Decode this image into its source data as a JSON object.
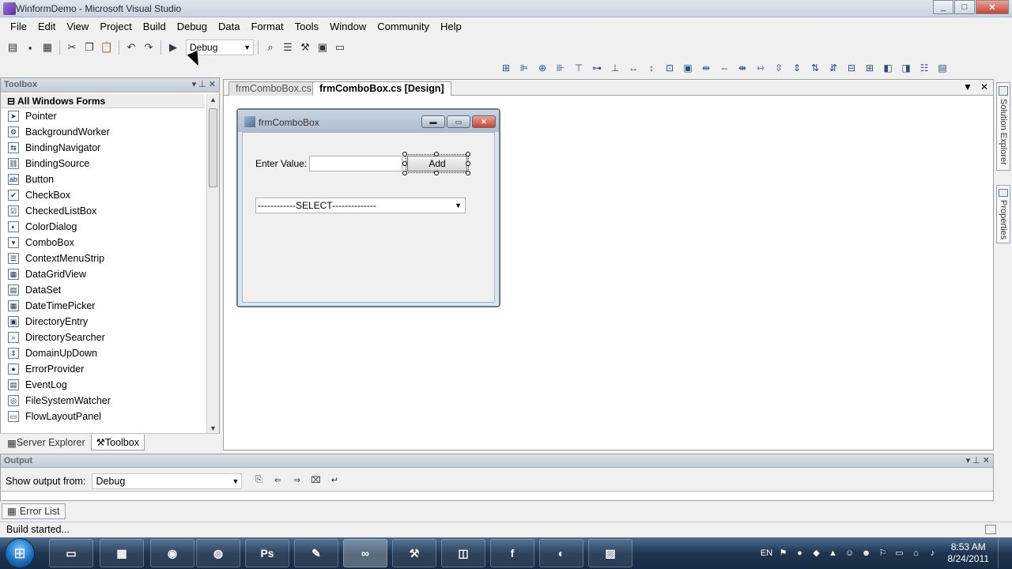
{
  "window": {
    "title": "WinformDemo - Microsoft Visual Studio",
    "controls": [
      "_",
      "□",
      "✕"
    ]
  },
  "menu": [
    "File",
    "Edit",
    "View",
    "Project",
    "Build",
    "Debug",
    "Data",
    "Format",
    "Tools",
    "Window",
    "Community",
    "Help"
  ],
  "toolbar": {
    "config_value": "Debug"
  },
  "toolbox": {
    "title": "Toolbox",
    "group": "All Windows Forms",
    "items": [
      {
        "label": "Pointer",
        "icon": "pointer-icon"
      },
      {
        "label": "BackgroundWorker",
        "icon": "background-worker-icon"
      },
      {
        "label": "BindingNavigator",
        "icon": "binding-navigator-icon"
      },
      {
        "label": "BindingSource",
        "icon": "binding-source-icon"
      },
      {
        "label": "Button",
        "icon": "button-icon"
      },
      {
        "label": "CheckBox",
        "icon": "checkbox-icon"
      },
      {
        "label": "CheckedListBox",
        "icon": "checked-listbox-icon"
      },
      {
        "label": "ColorDialog",
        "icon": "color-dialog-icon"
      },
      {
        "label": "ComboBox",
        "icon": "combobox-icon"
      },
      {
        "label": "ContextMenuStrip",
        "icon": "context-menu-strip-icon"
      },
      {
        "label": "DataGridView",
        "icon": "datagridview-icon"
      },
      {
        "label": "DataSet",
        "icon": "dataset-icon"
      },
      {
        "label": "DateTimePicker",
        "icon": "datetimepicker-icon"
      },
      {
        "label": "DirectoryEntry",
        "icon": "directory-entry-icon"
      },
      {
        "label": "DirectorySearcher",
        "icon": "directory-searcher-icon"
      },
      {
        "label": "DomainUpDown",
        "icon": "domain-updown-icon"
      },
      {
        "label": "ErrorProvider",
        "icon": "error-provider-icon"
      },
      {
        "label": "EventLog",
        "icon": "eventlog-icon"
      },
      {
        "label": "FileSystemWatcher",
        "icon": "filesystemwatcher-icon"
      },
      {
        "label": "FlowLayoutPanel",
        "icon": "flowlayoutpanel-icon"
      }
    ]
  },
  "panel_tabs": [
    "Server Explorer",
    "Toolbox"
  ],
  "document": {
    "tabs": [
      {
        "label": "frmComboBox.cs",
        "active": false
      },
      {
        "label": "frmComboBox.cs [Design]",
        "active": true
      }
    ],
    "form": {
      "title": "frmComboBox",
      "label": "Enter Value:",
      "textbox_value": "",
      "button": "Add",
      "combo_value": "------------SELECT--------------"
    }
  },
  "side_tabs": [
    "Solution Explorer",
    "Properties"
  ],
  "output": {
    "title": "Output",
    "show_from_label": "Show output from:",
    "source": "Debug"
  },
  "bottom_tabs": [
    "Error List"
  ],
  "status": "Build started...",
  "taskbar": {
    "language": "EN",
    "time": "8:53 AM",
    "date": "8/24/2011",
    "apps": [
      "explorer",
      "media",
      "app",
      "firefox",
      "Ps",
      "mind",
      "vs",
      "tools",
      "box",
      "f",
      "fs",
      "img"
    ]
  },
  "colors": {
    "accent": "#1e3450",
    "close_red": "#c7432d"
  }
}
